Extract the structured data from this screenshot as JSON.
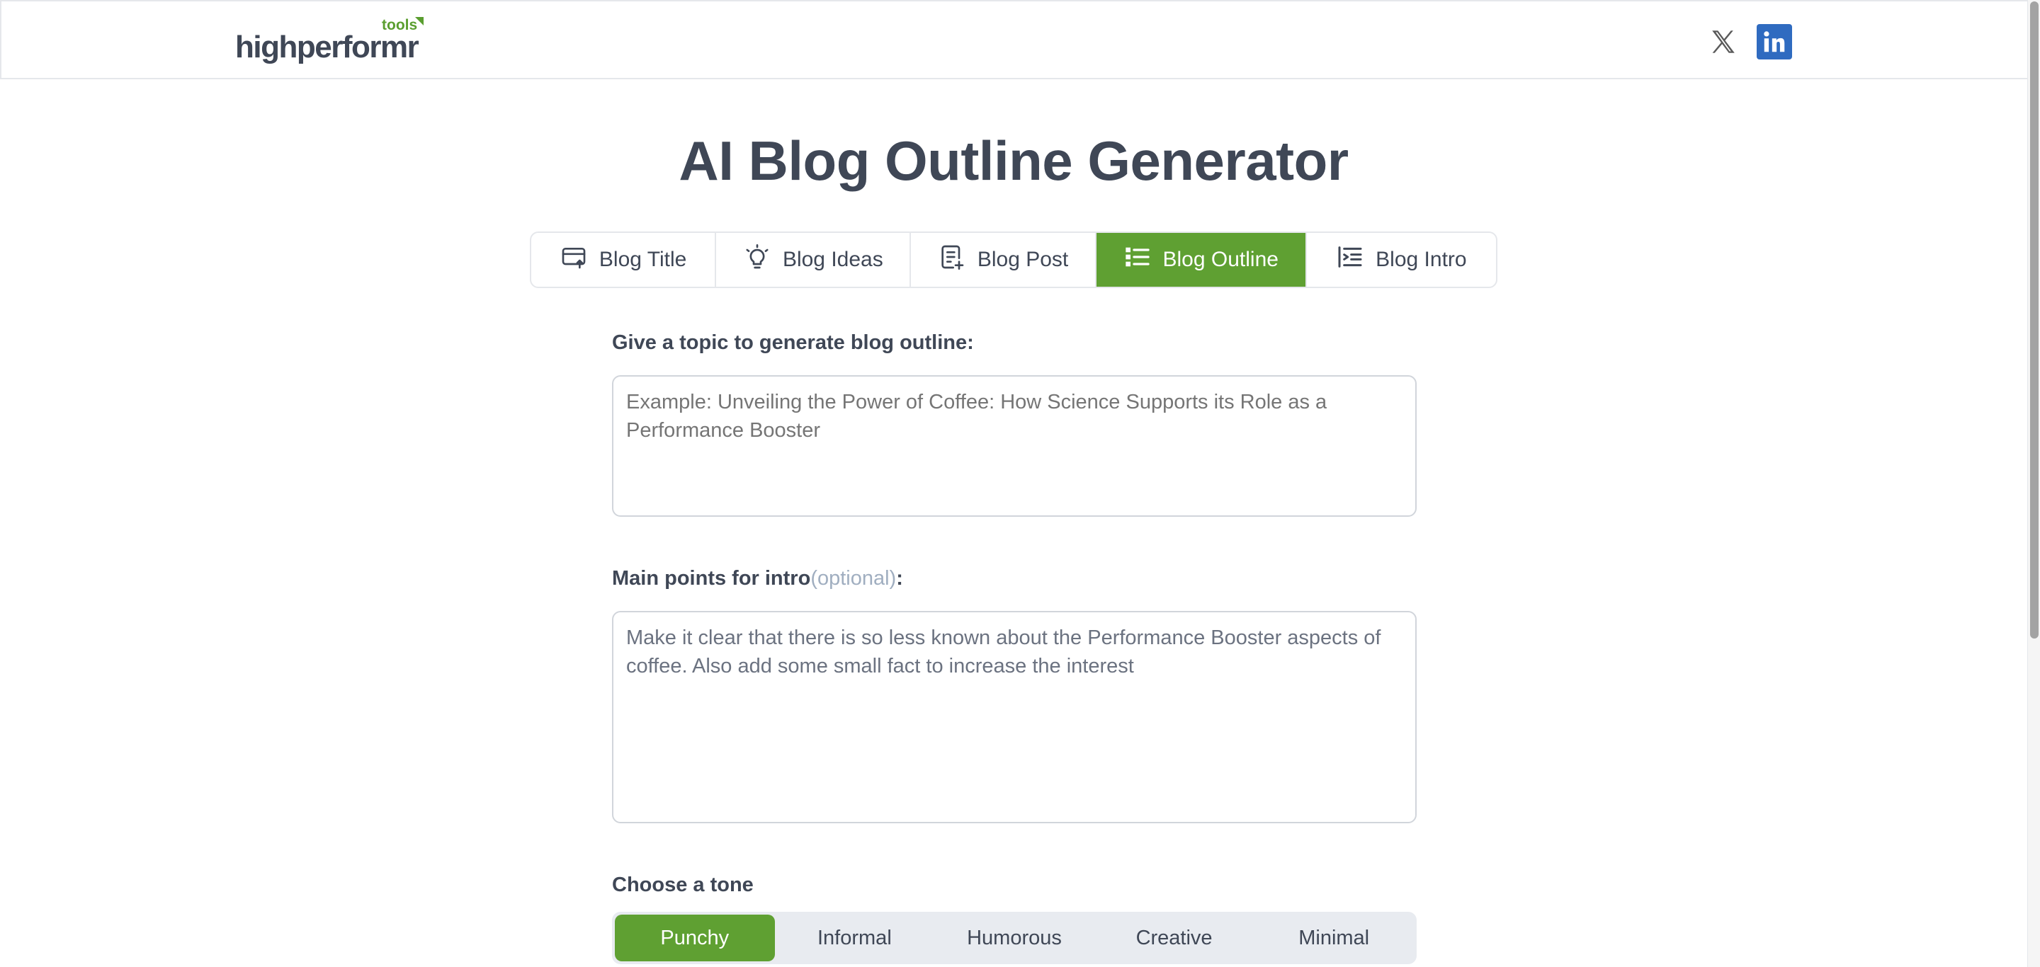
{
  "header": {
    "logo_text": "highperformr",
    "logo_tools": "tools",
    "social": [
      {
        "name": "x-icon",
        "color": "#555555"
      },
      {
        "name": "linkedin-icon",
        "color": "#2f6bc0"
      }
    ]
  },
  "page": {
    "title": "AI Blog Outline Generator"
  },
  "tabs": [
    {
      "label": "Blog Title",
      "icon": "card-upload-icon",
      "active": false
    },
    {
      "label": "Blog Ideas",
      "icon": "lightbulb-icon",
      "active": false
    },
    {
      "label": "Blog Post",
      "icon": "document-add-icon",
      "active": false
    },
    {
      "label": "Blog Outline",
      "icon": "list-icon",
      "active": true
    },
    {
      "label": "Blog Intro",
      "icon": "text-list-icon",
      "active": false
    }
  ],
  "form": {
    "topic_label": "Give a topic to generate blog outline:",
    "topic_placeholder": "Example: Unveiling the Power of Coffee: How Science Supports its Role as a Performance Booster",
    "intro_label": "Main points for intro",
    "intro_optional": "(optional)",
    "intro_colon": ":",
    "intro_value": "Make it clear that there is so less known about the Performance Booster aspects of coffee. Also add some small fact to increase the interest",
    "tone_label": "Choose a tone",
    "tones": [
      {
        "label": "Punchy",
        "active": true
      },
      {
        "label": "Informal",
        "active": false
      },
      {
        "label": "Humorous",
        "active": false
      },
      {
        "label": "Creative",
        "active": false
      },
      {
        "label": "Minimal",
        "active": false
      }
    ]
  },
  "colors": {
    "accent": "#5fa032",
    "text": "#3f4756",
    "muted": "#a0aec0"
  }
}
